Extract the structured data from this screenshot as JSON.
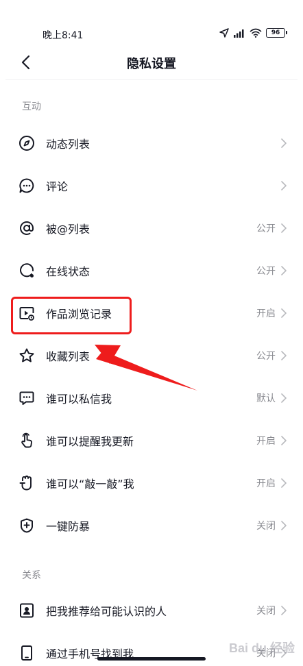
{
  "status_bar": {
    "time": "晚上8:41",
    "battery": "96"
  },
  "nav": {
    "title": "隐私设置"
  },
  "sections": [
    {
      "header": "互动"
    },
    {
      "header": "关系"
    }
  ],
  "rows": [
    {
      "label": "动态列表",
      "value": "",
      "icon": "compass-icon"
    },
    {
      "label": "评论",
      "value": "",
      "icon": "comment-icon"
    },
    {
      "label": "被@列表",
      "value": "公开",
      "icon": "at-icon"
    },
    {
      "label": "在线状态",
      "value": "公开",
      "icon": "online-status-icon"
    },
    {
      "label": "作品浏览记录",
      "value": "开启",
      "icon": "video-history-icon"
    },
    {
      "label": "收藏列表",
      "value": "公开",
      "icon": "star-icon"
    },
    {
      "label": "谁可以私信我",
      "value": "默认",
      "icon": "message-icon"
    },
    {
      "label": "谁可以提醒我更新",
      "value": "开启",
      "icon": "tap-hand-icon"
    },
    {
      "label": "谁可以“敲一敲”我",
      "value": "开启",
      "icon": "knock-hand-icon"
    },
    {
      "label": "一键防暴",
      "value": "关闭",
      "icon": "shield-plus-icon"
    },
    {
      "label": "把我推荐给可能认识的人",
      "value": "关闭",
      "icon": "contact-card-icon"
    },
    {
      "label": "通过手机号找到我",
      "value": "关闭",
      "icon": "phone-icon"
    }
  ],
  "watermark": "Bai du 经验",
  "colors": {
    "highlight": "#ee1c1c",
    "text": "#161823",
    "secondary": "#8a8b91"
  }
}
